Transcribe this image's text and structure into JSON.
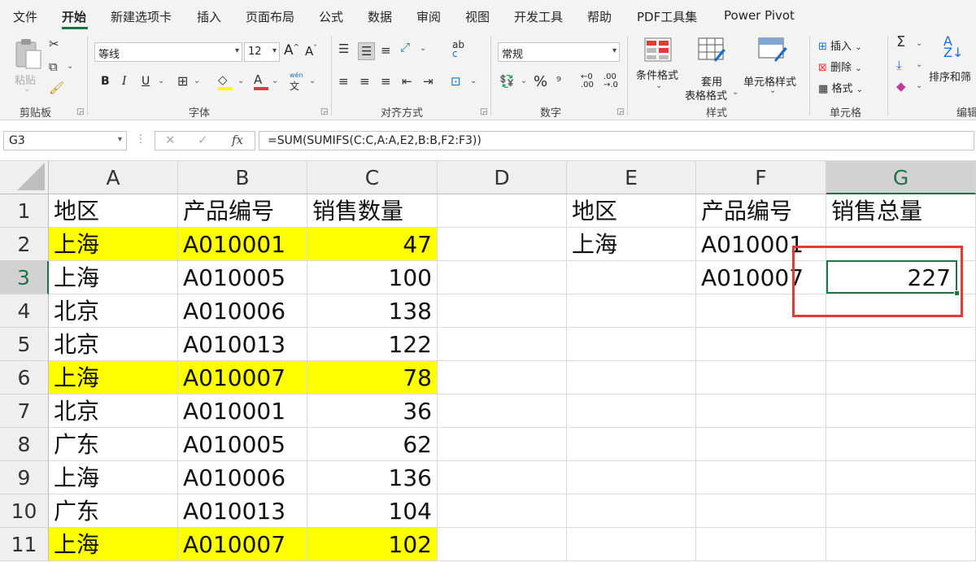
{
  "menu": {
    "tabs": [
      "文件",
      "开始",
      "新建选项卡",
      "插入",
      "页面布局",
      "公式",
      "数据",
      "审阅",
      "视图",
      "开发工具",
      "帮助",
      "PDF工具集",
      "Power Pivot"
    ],
    "active": "开始"
  },
  "ribbon": {
    "clipboard": {
      "paste": "粘贴",
      "group": "剪贴板"
    },
    "font": {
      "name": "等线",
      "size": "12",
      "grow": "A",
      "shrink": "A",
      "bold": "B",
      "italic": "I",
      "underline": "U",
      "color_a": "A",
      "phonetic": "wén",
      "phonetic_char": "文",
      "group": "字体"
    },
    "alignment": {
      "group": "对齐方式",
      "wrap": "ab",
      "wrap2": "c"
    },
    "number": {
      "format": "常规",
      "percent": "%",
      "group": "数字"
    },
    "styles": {
      "conditional": "条件格式",
      "table_line1": "套用",
      "table_line2": "表格格式",
      "cell_styles": "单元格样式",
      "group": "样式"
    },
    "cells": {
      "insert": "插入",
      "delete": "删除",
      "format": "格式",
      "group": "单元格"
    },
    "editing": {
      "sort": "排序和筛",
      "group": "编辑"
    }
  },
  "formula_bar": {
    "name_box": "G3",
    "fx": "fx",
    "formula": "=SUM(SUMIFS(C:C,A:A,E2,B:B,F2:F3))"
  },
  "sheet": {
    "columns": [
      "A",
      "B",
      "C",
      "D",
      "E",
      "F",
      "G"
    ],
    "rows": [
      {
        "n": "1",
        "A": "地区",
        "B": "产品编号",
        "C": "销售数量",
        "E": "地区",
        "F": "产品编号",
        "G": "销售总量",
        "hl": false
      },
      {
        "n": "2",
        "A": "上海",
        "B": "A010001",
        "C": "47",
        "E": "上海",
        "F": "A010001",
        "G": "",
        "hl": true
      },
      {
        "n": "3",
        "A": "上海",
        "B": "A010005",
        "C": "100",
        "E": "",
        "F": "A010007",
        "G": "227",
        "hl": false
      },
      {
        "n": "4",
        "A": "北京",
        "B": "A010006",
        "C": "138",
        "E": "",
        "F": "",
        "G": "",
        "hl": false
      },
      {
        "n": "5",
        "A": "北京",
        "B": "A010013",
        "C": "122",
        "E": "",
        "F": "",
        "G": "",
        "hl": false
      },
      {
        "n": "6",
        "A": "上海",
        "B": "A010007",
        "C": "78",
        "E": "",
        "F": "",
        "G": "",
        "hl": true
      },
      {
        "n": "7",
        "A": "北京",
        "B": "A010001",
        "C": "36",
        "E": "",
        "F": "",
        "G": "",
        "hl": false
      },
      {
        "n": "8",
        "A": "广东",
        "B": "A010005",
        "C": "62",
        "E": "",
        "F": "",
        "G": "",
        "hl": false
      },
      {
        "n": "9",
        "A": "上海",
        "B": "A010006",
        "C": "136",
        "E": "",
        "F": "",
        "G": "",
        "hl": false
      },
      {
        "n": "10",
        "A": "广东",
        "B": "A010013",
        "C": "104",
        "E": "",
        "F": "",
        "G": "",
        "hl": false
      },
      {
        "n": "11",
        "A": "上海",
        "B": "A010007",
        "C": "102",
        "E": "",
        "F": "",
        "G": "",
        "hl": true
      }
    ],
    "selected_col": "G",
    "selected_row": "3",
    "highlight_color": "#ffff00",
    "annotation_color": "#e53935"
  }
}
